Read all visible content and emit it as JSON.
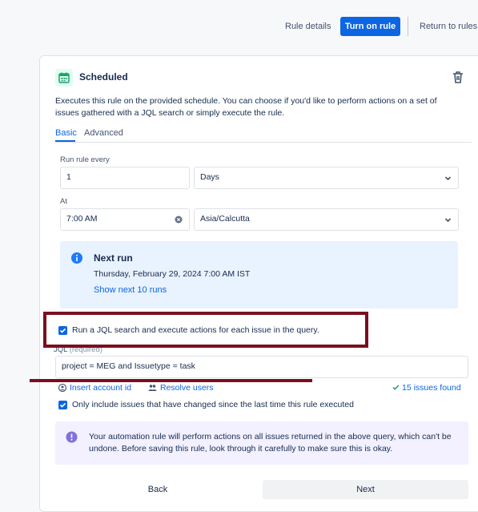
{
  "header": {
    "rule_details_label": "Rule details",
    "turn_on_label": "Turn on rule",
    "return_label": "Return to rules"
  },
  "trigger": {
    "title": "Scheduled",
    "description": "Executes this rule on the provided schedule. You can choose if you'd like to perform actions on a set of issues gathered with a JQL search or simply execute the rule.",
    "icon": "calendar-icon"
  },
  "tabs": [
    {
      "label": "Basic",
      "active": true
    },
    {
      "label": "Advanced",
      "active": false
    }
  ],
  "schedule": {
    "run_every_label": "Run rule every",
    "run_every_value": "1",
    "unit_value": "Days",
    "at_label": "At",
    "time_value": "7:00 AM",
    "timezone_value": "Asia/Calcutta"
  },
  "next_run": {
    "title": "Next run",
    "date": "Thursday, February 29, 2024 7:00 AM IST",
    "show_more_label": "Show next 10 runs"
  },
  "jql": {
    "checkbox_label": "Run a JQL search and execute actions for each issue in the query.",
    "checked": true,
    "label": "JQL",
    "required": "(required)",
    "query": "project = MEG and Issuetype = task",
    "insert_account_label": "Insert account id",
    "resolve_users_label": "Resolve users",
    "issues_found": "15 issues found",
    "only_changed_label": "Only include issues that have changed since the last time this rule executed",
    "only_changed_checked": true
  },
  "warning": {
    "text": "Your automation rule will perform actions on all issues returned in the above query, which can't be undone. Before saving this rule, look through it carefully to make sure this is okay."
  },
  "footer": {
    "back_label": "Back",
    "next_label": "Next"
  },
  "colors": {
    "primary": "#0c66e4",
    "annotation": "#7a0f1f",
    "info_bg": "#e9f2ff",
    "warning_bg": "#f3f0ff"
  }
}
